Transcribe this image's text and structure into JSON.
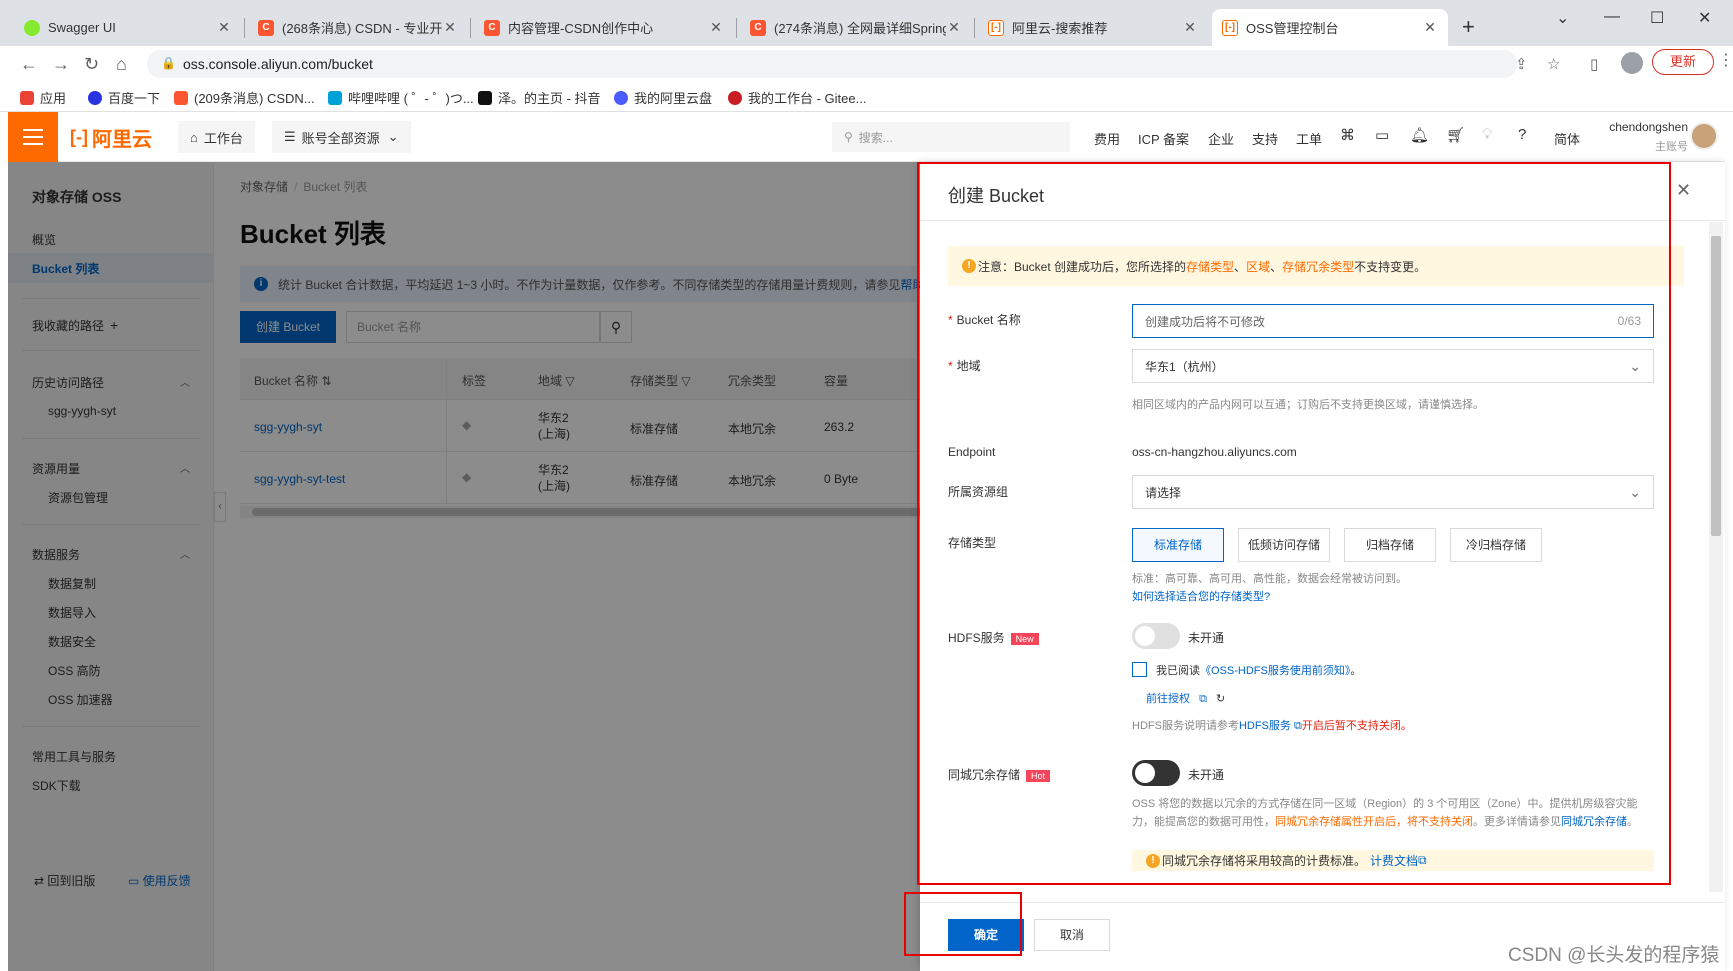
{
  "browser": {
    "tabs": [
      {
        "title": "Swagger UI",
        "icon": "swagger-icon",
        "color": "#85ea2d"
      },
      {
        "title": "(268条消息) CSDN - 专业开发者",
        "icon": "csdn-icon",
        "color": "#fc5531"
      },
      {
        "title": "内容管理-CSDN创作中心",
        "icon": "csdn-icon",
        "color": "#fc5531"
      },
      {
        "title": "(274条消息) 全网最详细SpringB",
        "icon": "csdn-icon",
        "color": "#fc5531"
      },
      {
        "title": "阿里云-搜索推荐",
        "icon": "aliyun-icon",
        "color": "#ff6a00"
      },
      {
        "title": "OSS管理控制台",
        "icon": "aliyun-icon",
        "color": "#ff6a00"
      }
    ],
    "url": "oss.console.aliyun.com/bucket",
    "update_label": "更新",
    "bookmarks": [
      {
        "label": "应用",
        "color": "#ea4335"
      },
      {
        "label": "百度一下",
        "color": "#2932e1"
      },
      {
        "label": "(209条消息) CSDN...",
        "color": "#fc5531"
      },
      {
        "label": "哔哩哔哩 ( ゜- ゜)つ...",
        "color": "#00a1d6"
      },
      {
        "label": "泽。的主页 - 抖音",
        "color": "#111111"
      },
      {
        "label": "我的阿里云盘",
        "color": "#4a5cff"
      },
      {
        "label": "我的工作台 - Gitee...",
        "color": "#c71d23"
      }
    ]
  },
  "topnav": {
    "logo": "阿里云",
    "workbench": "工作台",
    "resources": "账号全部资源",
    "search_placeholder": "搜索...",
    "links": [
      "费用",
      "ICP 备案",
      "企业",
      "支持",
      "工单"
    ],
    "lang": "简体",
    "username": "chendongshen",
    "role": "主账号"
  },
  "sidebar": {
    "title": "对象存储 OSS",
    "overview": "概览",
    "bucket_list": "Bucket 列表",
    "favorites": "我收藏的路径",
    "history": "历史访问路径",
    "history_item": "sgg-yygh-syt",
    "resource_usage": "资源用量",
    "resource_pkg": "资源包管理",
    "data_services": "数据服务",
    "data_items": [
      "数据复制",
      "数据导入",
      "数据安全",
      "OSS 高防",
      "OSS 加速器"
    ],
    "tools": "常用工具与服务",
    "sdk": "SDK下载",
    "old_version": "回到旧版",
    "feedback": "使用反馈"
  },
  "main": {
    "breadcrumb_root": "对象存储",
    "breadcrumb_current": "Bucket 列表",
    "title": "Bucket 列表",
    "notice": "统计 Bucket 合计数据，平均延迟 1~3 小时。不作为计量数据，仅作参考。不同存储类型的存储用量计费规则，请参见",
    "notice_link": "帮助",
    "create_btn": "创建 Bucket",
    "search_placeholder": "Bucket 名称",
    "columns": [
      "Bucket 名称",
      "标签",
      "地域",
      "存储类型",
      "冗余类型",
      "容量"
    ],
    "rows": [
      {
        "name": "sgg-yygh-syt",
        "region_1": "华东2",
        "region_2": "(上海)",
        "storage": "标准存储",
        "redundancy": "本地冗余",
        "capacity": "263.2"
      },
      {
        "name": "sgg-yygh-syt-test",
        "region_1": "华东2",
        "region_2": "(上海)",
        "storage": "标准存储",
        "redundancy": "本地冗余",
        "capacity": "0 Byte"
      }
    ]
  },
  "drawer": {
    "title": "创建 Bucket",
    "warn_prefix": "注意：Bucket 创建成功后，您所选择的",
    "warn_t1": "存储类型",
    "warn_sep1": "、",
    "warn_t2": "区域",
    "warn_sep2": "、",
    "warn_t3": "存储冗余类型",
    "warn_suffix": "不支持变更。",
    "name_label": "Bucket 名称",
    "name_placeholder": "创建成功后将不可修改",
    "name_count": "0/63",
    "region_label": "地域",
    "region_value": "华东1（杭州）",
    "region_help": "相同区域内的产品内网可以互通；订购后不支持更换区域，请谨慎选择。",
    "endpoint_label": "Endpoint",
    "endpoint_value": "oss-cn-hangzhou.aliyuncs.com",
    "resgroup_label": "所属资源组",
    "resgroup_placeholder": "请选择",
    "storage_label": "存储类型",
    "storage_options": [
      "标准存储",
      "低频访问存储",
      "归档存储",
      "冷归档存储"
    ],
    "storage_help": "标准：高可靠、高可用、高性能，数据会经常被访问到。",
    "storage_link": "如何选择适合您的存储类型?",
    "hdfs_label": "HDFS服务",
    "hdfs_badge": "New",
    "hdfs_status": "未开通",
    "hdfs_agree_prefix": "我已阅读",
    "hdfs_agree_link": "《OSS-HDFS服务使用前须知》",
    "hdfs_agree_suffix": "。",
    "hdfs_auth": "前往授权",
    "hdfs_help_prefix": "HDFS服务说明请参考",
    "hdfs_help_link": "HDFS服务",
    "hdfs_help_red": "开启后暂不支持关闭。",
    "zrs_label": "同城冗余存储",
    "zrs_badge": "Hot",
    "zrs_status": "未开通",
    "zrs_desc_1": "OSS 将您的数据以冗余的方式存储在同一区域（Region）的 3 个可用区（Zone）中。提供机房级容灾能力，能提高您的数据可用性，",
    "zrs_desc_red": "同城冗余存储属性开启后，将不支持关闭",
    "zrs_desc_2": "。更多详情请参见",
    "zrs_desc_link": "同城冗余存储",
    "zrs_desc_end": "。",
    "zrs_warn": "同城冗余存储将采用较高的计费标准。",
    "zrs_warn_link": "计费文档",
    "ok": "确定",
    "cancel": "取消"
  },
  "watermark": "CSDN @长头发的程序猿",
  "colors": {
    "brand": "#ff6a00",
    "primary": "#0064c8",
    "highlight": "#e60000"
  }
}
